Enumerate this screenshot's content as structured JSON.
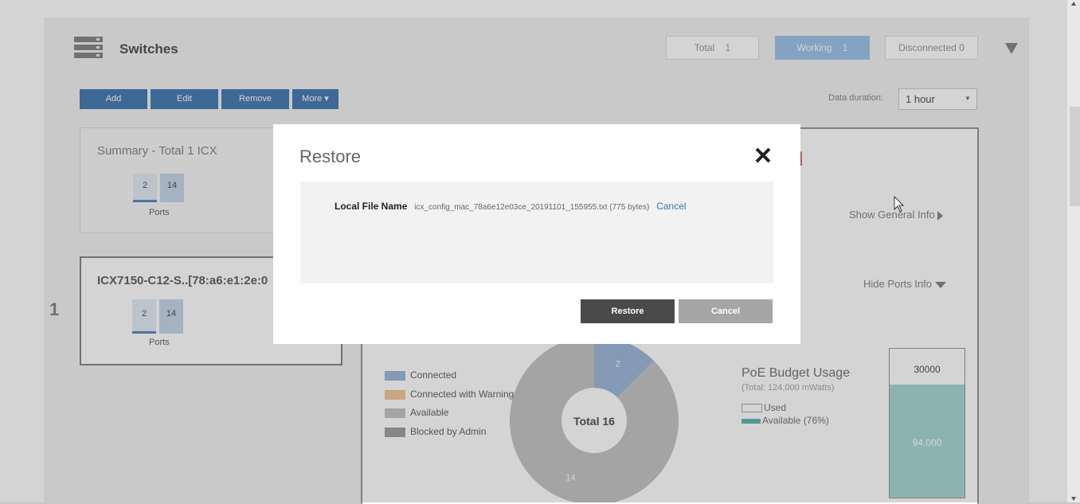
{
  "header": {
    "title": "Switches",
    "stats": {
      "total_label": "Total",
      "total_value": "1",
      "working_label": "Working",
      "working_value": "1",
      "disconnected_label": "Disconnected",
      "disconnected_value": "0"
    }
  },
  "toolbar": {
    "add": "Add",
    "edit": "Edit",
    "remove": "Remove",
    "more": "More ▾"
  },
  "duration": {
    "label": "Data duration:",
    "value": "1 hour"
  },
  "summary_card": {
    "title": "Summary - Total 1 ICX",
    "bar1": "2",
    "bar2": "14",
    "caption": "Ports"
  },
  "device_card": {
    "index": "1",
    "title": "ICX7150-C12-S..[78:a6:e1:2e:0",
    "bar1": "2",
    "bar2": "14",
    "caption": "Ports"
  },
  "detail": {
    "bracket": "]",
    "show_general": "Show General Info",
    "hide_ports": "Hide Ports Info",
    "legend": [
      "Connected",
      "Connected with Warning",
      "Available",
      "Blocked by Admin"
    ],
    "donut_center": "Total 16",
    "poe_title": "PoE Budget Usage",
    "poe_total": "(Total: 124,000 mWatts)",
    "poe_used": "Used",
    "poe_available": "Available (76%)",
    "poe_top": "30000",
    "poe_bottom": "94,000"
  },
  "chart_data": {
    "type": "pie",
    "categories": [
      "Connected",
      "Available"
    ],
    "values": [
      2,
      14
    ],
    "title": "Total 16"
  },
  "poe_data": {
    "total": 124000,
    "available": 94000,
    "available_pct": 76
  },
  "modal": {
    "title": "Restore",
    "field_label": "Local File Name",
    "file_name": "icx_config_mac_78a6e12e03ce_20191101_155955.txt (775 bytes)",
    "file_cancel": "Cancel",
    "restore_button": "Restore",
    "cancel_button": "Cancel"
  },
  "colors": {
    "connected": "#9fb8d8",
    "warning": "#f2c89b",
    "available": "#c6c6c6",
    "blocked": "#a3a3a3",
    "poe_available": "#a8d8d6",
    "accent": "#4a7fb5"
  }
}
